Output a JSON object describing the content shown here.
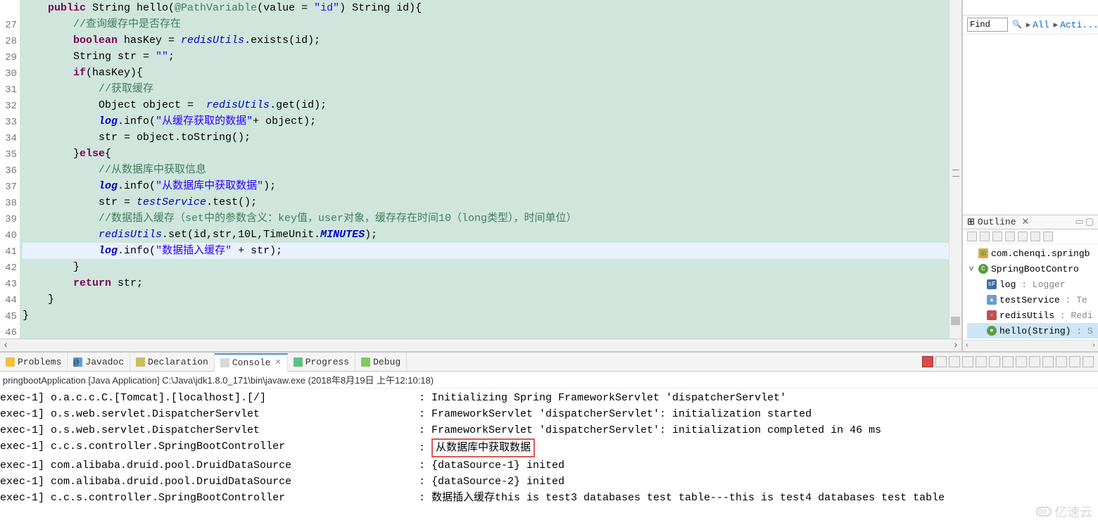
{
  "gutter": [
    "",
    "27",
    "28",
    "29",
    "30",
    "31",
    "32",
    "33",
    "34",
    "35",
    "36",
    "37",
    "38",
    "39",
    "40",
    "41",
    "42",
    "43",
    "44",
    "45",
    "46"
  ],
  "code": {
    "l0a": "    public",
    "l0b": " String hello(",
    "l0c": "@PathVariable",
    "l0d": "(value = ",
    "l0e": "\"id\"",
    "l0f": ") String id){",
    "l1": "        //查询缓存中是否存在",
    "l2a": "        boolean",
    "l2b": " hasKey = ",
    "l2c": "redisUtils",
    "l2d": ".exists(id);",
    "l3a": "        String str = ",
    "l3b": "\"\"",
    "l3c": ";",
    "l4a": "        if",
    "l4b": "(hasKey){",
    "l5": "            //获取缓存",
    "l6a": "            Object object =  ",
    "l6b": "redisUtils",
    "l6c": ".get(id);",
    "l7a": "            ",
    "l7b": "log",
    "l7c": ".info(",
    "l7d": "\"从缓存获取的数据\"",
    "l7e": "+ object);",
    "l8": "            str = object.toString();",
    "l9a": "        }",
    "l9b": "else",
    "l9c": "{",
    "l10": "            //从数据库中获取信息",
    "l11a": "            ",
    "l11b": "log",
    "l11c": ".info(",
    "l11d": "\"从数据库中获取数据\"",
    "l11e": ");",
    "l12a": "            str = ",
    "l12b": "testService",
    "l12c": ".test();",
    "l13": "            //数据插入缓存（set中的参数含义：key值，user对象，缓存存在时间10（long类型），时间单位）",
    "l14a": "            ",
    "l14b": "redisUtils",
    "l14c": ".set(id,str,10L,TimeUnit.",
    "l14d": "MINUTES",
    "l14e": ");",
    "l15a": "            ",
    "l15b": "log",
    "l15c": ".info(",
    "l15d": "\"数据插入缓存\"",
    "l15e": " + str);",
    "l16": "        }",
    "l17a": "        return",
    "l17b": " str;",
    "l18": "    }",
    "l19": "}",
    "l20": ""
  },
  "find": {
    "label": "Find",
    "links": {
      "all": "All",
      "acti": "Acti..."
    }
  },
  "outline": {
    "title": "Outline",
    "pkg": "com.chenqi.springb",
    "cls": "SpringBootContro",
    "f1": "log",
    "f1t": " : Logger",
    "f2": "testService",
    "f2t": " : Te",
    "f3": "redisUtils",
    "f3t": " : Redi",
    "m1": "hello(String)",
    "m1t": " : S"
  },
  "tabs": {
    "problems": "Problems",
    "javadoc": "Javadoc",
    "declaration": "Declaration",
    "console": "Console",
    "progress": "Progress",
    "debug": "Debug"
  },
  "console": {
    "subtitle": "pringbootApplication [Java Application] C:\\Java\\jdk1.8.0_171\\bin\\javaw.exe (2018年8月19日 上午12:10:18)",
    "lines": [
      {
        "p1": "exec-1] o.a.c.c.C.[Tomcat].[localhost].[/]",
        "p2": ": Initializing Spring FrameworkServlet 'dispatcherServlet'"
      },
      {
        "p1": "exec-1] o.s.web.servlet.DispatcherServlet",
        "p2": ": FrameworkServlet 'dispatcherServlet': initialization started"
      },
      {
        "p1": "exec-1] o.s.web.servlet.DispatcherServlet",
        "p2": ": FrameworkServlet 'dispatcherServlet': initialization completed in 46 ms"
      },
      {
        "p1": "exec-1] c.c.s.controller.SpringBootController",
        "p2": ": ",
        "msg": "从数据库中获取数据",
        "hl": true
      },
      {
        "p1": "exec-1] com.alibaba.druid.pool.DruidDataSource",
        "p2": ": {dataSource-1} inited"
      },
      {
        "p1": "exec-1] com.alibaba.druid.pool.DruidDataSource",
        "p2": ": {dataSource-2} inited"
      },
      {
        "p1": "exec-1] c.c.s.controller.SpringBootController",
        "p2": ": 数据插入缓存this is test3 databases test table---this is test4 databases test table"
      }
    ]
  },
  "watermark": "亿速云"
}
